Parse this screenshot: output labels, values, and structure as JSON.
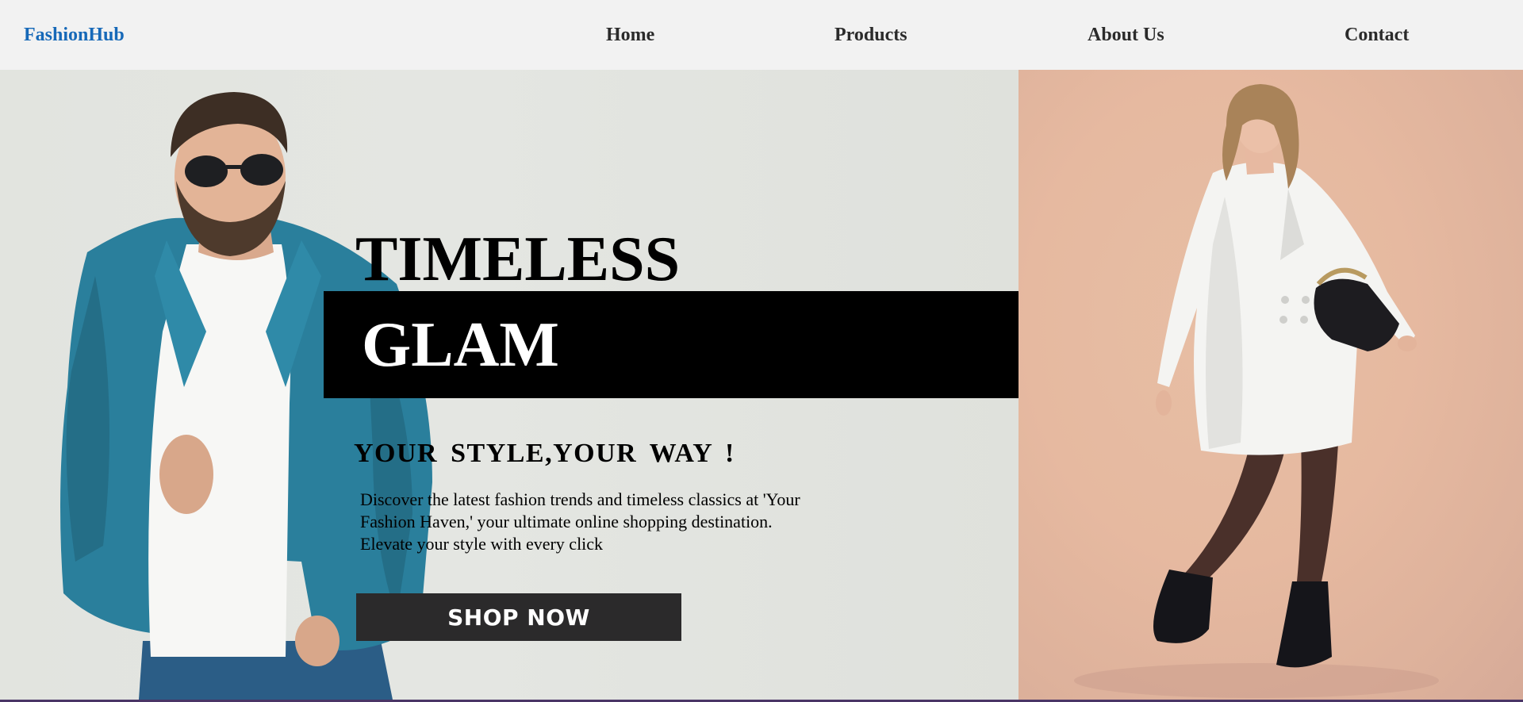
{
  "brand": {
    "name": "FashionHub",
    "color": "#1769b8"
  },
  "nav": {
    "items": [
      {
        "label": "Home"
      },
      {
        "label": "Products"
      },
      {
        "label": "About Us"
      },
      {
        "label": "Contact"
      }
    ]
  },
  "hero": {
    "headline_line1": "TIMELESS",
    "headline_line2": "GLAM",
    "tagline": "YOUR STYLE,YOUR WAY !",
    "description": "Discover the latest fashion trends and timeless classics at 'Your Fashion Haven,' your ultimate online shopping destination. Elevate your style with every click",
    "cta_label": "SHOP NOW",
    "images": {
      "left": "man-in-denim-jacket-photo",
      "right": "woman-in-white-coat-photo"
    }
  },
  "colors": {
    "nav_background": "#f2f2f2",
    "hero_left_background": "#e2e4df",
    "hero_right_background": "#e6b9a0",
    "band": "#000000",
    "button": "#2b2a2b",
    "bottom_line": "#4a3566"
  }
}
